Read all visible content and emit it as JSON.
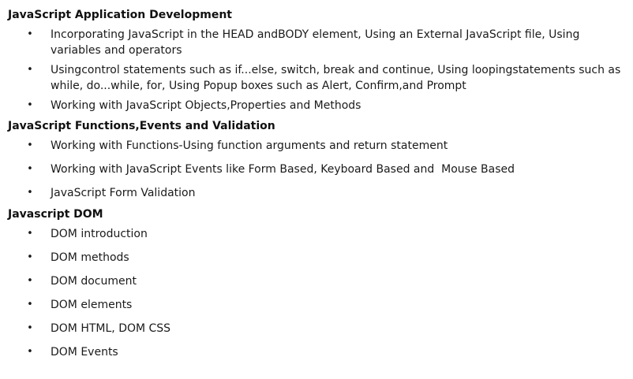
{
  "sections": [
    {
      "title": "JavaScript Application Development",
      "items": [
        "Incorporating JavaScript in the HEAD andBODY element, Using an External JavaScript file, Using variables and operators",
        "Usingcontrol statements such as if...else, switch, break and continue, Using loopingstatements such as while, do...while, for, Using Popup boxes such as Alert, Confirm,and Prompt",
        "Working with JavaScript Objects,Properties and Methods"
      ]
    },
    {
      "title": "JavaScript Functions,Events and Validation",
      "items": [
        "Working with Functions-Using function arguments and return statement",
        "Working with JavaScript Events like Form Based, Keyboard Based and  Mouse Based",
        "JavaScript Form Validation"
      ]
    },
    {
      "title": "Javascript DOM",
      "items": [
        "DOM introduction",
        "DOM methods",
        "DOM document",
        "DOM elements",
        "DOM HTML, DOM CSS",
        "DOM Events"
      ]
    }
  ],
  "bullet_symbol": "•"
}
